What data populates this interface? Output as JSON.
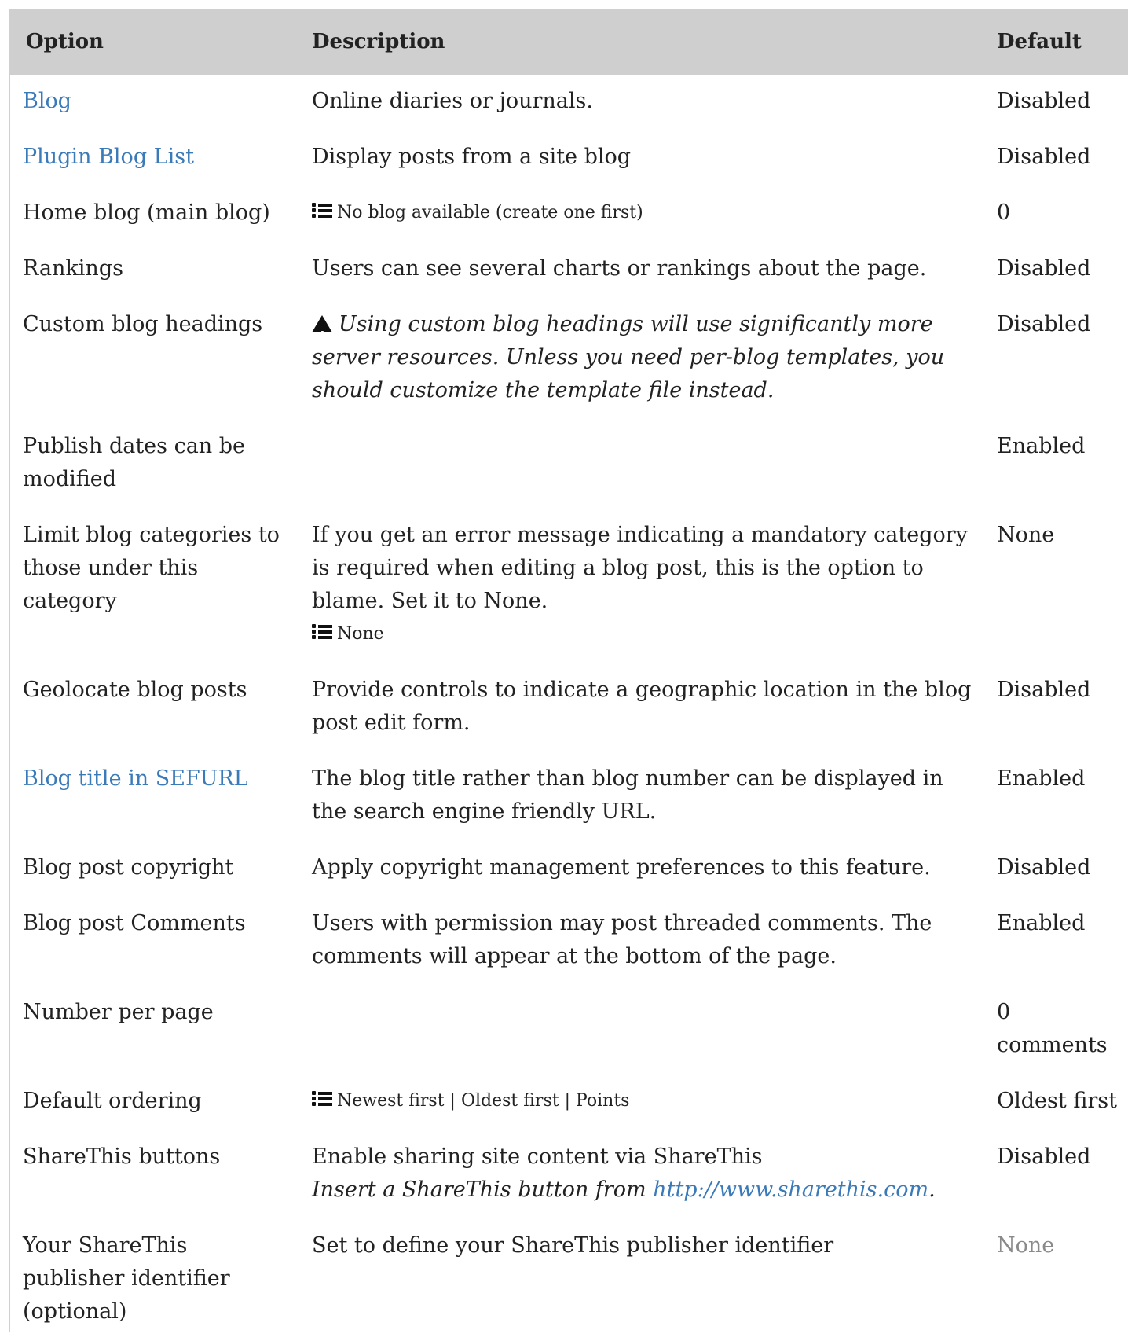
{
  "table": {
    "headers": {
      "option": "Option",
      "description": "Description",
      "default": "Default"
    },
    "rows": [
      {
        "option": "Blog",
        "option_link": true,
        "description": "Online diaries or journals.",
        "default": "Disabled"
      },
      {
        "option": "Plugin Blog List",
        "option_link": true,
        "description": "Display posts from a site blog",
        "default": "Disabled"
      },
      {
        "option": "Home blog (main blog)",
        "description_list": "No blog available (create one first)",
        "default": "0"
      },
      {
        "option": "Rankings",
        "description": "Users can see several charts or rankings about the page.",
        "default": "Disabled"
      },
      {
        "option": "Custom blog headings",
        "description_warning": "Using custom blog headings will use significantly more server resources. Unless you need per-blog templates, you should customize the template file instead.",
        "default": "Disabled"
      },
      {
        "option": "Publish dates can be modified",
        "description": "",
        "default": "Enabled"
      },
      {
        "option": "Limit blog categories to those under this category",
        "description": "If you get an error message indicating a mandatory category is required when editing a blog post, this is the option to blame. Set it to None.",
        "description_list": "None",
        "default": "None"
      },
      {
        "option": "Geolocate blog posts",
        "description": "Provide controls to indicate a geographic location in the blog post edit form.",
        "default": "Disabled"
      },
      {
        "option": "Blog title in SEFURL",
        "option_link": true,
        "description": "The blog title rather than blog number can be displayed in the search engine friendly URL.",
        "default": "Enabled"
      },
      {
        "option": "Blog post copyright",
        "description": "Apply copyright management preferences to this feature.",
        "default": "Disabled"
      },
      {
        "option": "Blog post Comments",
        "description": "Users with permission may post threaded comments. The comments will appear at the bottom of the page.",
        "default": "Enabled"
      },
      {
        "option": "Number per page",
        "description": "",
        "default": "0 comments"
      },
      {
        "option": "Default ordering",
        "description_list": "Newest first | Oldest first | Points",
        "default": "Oldest first"
      },
      {
        "option": "ShareThis buttons",
        "description": "Enable sharing site content via ShareThis",
        "description_note_prefix": "Insert a ShareThis button from ",
        "description_note_link": "http://www.sharethis.com",
        "description_note_suffix": ".",
        "default": "Disabled"
      },
      {
        "option": "Your ShareThis publisher identifier (optional)",
        "description": "Set to define your ShareThis publisher identifier",
        "default": "None",
        "default_muted": true
      }
    ]
  },
  "icons": {
    "list": "list-icon",
    "warning": "warning-icon"
  },
  "colors": {
    "link": "#3a7ab8",
    "header_bg": "#cfcfcf",
    "muted": "#8a8a8a"
  }
}
